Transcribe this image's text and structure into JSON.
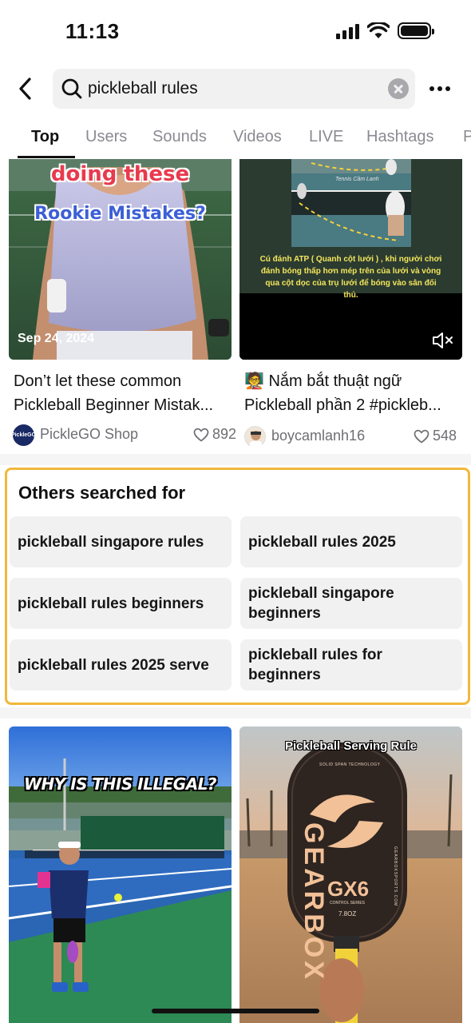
{
  "status": {
    "time": "11:13"
  },
  "search": {
    "query": "pickleball rules"
  },
  "tabs": [
    "Top",
    "Users",
    "Sounds",
    "Videos",
    "LIVE",
    "Hashtags",
    "P"
  ],
  "videos": [
    {
      "overlay_top": "doing these",
      "overlay_bottom": "Rookie Mistakes?",
      "date": "Sep 24, 2024",
      "caption_line1": "Don’t let these common",
      "caption_line2": "Pickleball Beginner Mistak...",
      "author": "PickleGO Shop",
      "avatar_text": "PickleGO",
      "likes": "892"
    },
    {
      "overlay_label": "Tennis Cầm Lanh",
      "overlay_text": "Cú đánh ATP ( Quanh cột lưới ) , khi người chơi đánh bóng thấp hơn mép trên của lưới và vòng qua cột dọc của trụ lưới để bóng vào sân đối thủ.",
      "caption_emoji": "🧑‍🏫",
      "caption_line1": "Nắm bắt thuật ngữ",
      "caption_line2": "Pickleball phần 2 #pickleb...",
      "author": "boycamlanh16",
      "likes": "548"
    },
    {
      "overlay_text": "WHY IS THIS ILLEGAL?"
    },
    {
      "overlay_text": "Pickleball Serving Rule",
      "paddle_brand": "GEARBOX",
      "paddle_model": "GX6",
      "paddle_small_top": "SOLID SPAN TECHNOLOGY",
      "paddle_small_bottom": "CONTROL SERIES",
      "paddle_weight": "7.8OZ",
      "paddle_site": "GEARBOXSPORTS.COM"
    }
  ],
  "others": {
    "title": "Others searched for",
    "suggestions": [
      "pickleball singapore rules",
      "pickleball rules 2025",
      "pickleball rules beginners",
      "pickleball singapore beginners",
      "pickleball rules 2025 serve",
      "pickleball rules for beginners"
    ]
  },
  "colors": {
    "highlight_border": "#f2b73c",
    "chip_bg": "#f1f1f2",
    "muted_text": "#6e6e73"
  }
}
